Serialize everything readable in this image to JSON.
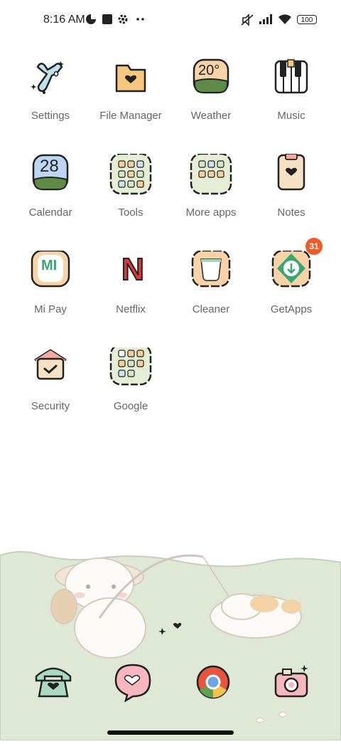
{
  "status_bar": {
    "time": "8:16 AM",
    "battery": "100",
    "icons": [
      "data-saver-icon",
      "stop-icon",
      "gear-icon",
      "more-dots-icon",
      "mute-icon",
      "signal-icon",
      "wifi-icon",
      "battery-icon"
    ]
  },
  "apps": [
    {
      "label": "Settings",
      "icon": "wrench-icon"
    },
    {
      "label": "File Manager",
      "icon": "folder-icon"
    },
    {
      "label": "Weather",
      "icon": "weather-icon",
      "text": "20°"
    },
    {
      "label": "Music",
      "icon": "piano-icon"
    },
    {
      "label": "Calendar",
      "icon": "calendar-icon",
      "text": "28"
    },
    {
      "label": "Tools",
      "icon": "tools-folder-icon"
    },
    {
      "label": "More apps",
      "icon": "more-apps-folder-icon"
    },
    {
      "label": "Notes",
      "icon": "notes-icon"
    },
    {
      "label": "Mi Pay",
      "icon": "mi-pay-icon",
      "text": "MI"
    },
    {
      "label": "Netflix",
      "icon": "netflix-icon",
      "text": "N"
    },
    {
      "label": "Cleaner",
      "icon": "cleaner-icon"
    },
    {
      "label": "GetApps",
      "icon": "getapps-icon",
      "badge": "31"
    },
    {
      "label": "Security",
      "icon": "security-house-icon"
    },
    {
      "label": "Google",
      "icon": "google-folder-icon"
    }
  ],
  "dock": [
    {
      "name": "phone-icon"
    },
    {
      "name": "messaging-icon"
    },
    {
      "name": "chrome-icon"
    },
    {
      "name": "camera-icon"
    }
  ],
  "colors": {
    "accent": "#ef5a28",
    "peach": "#f6d6a8",
    "grass": "#dfe8d4",
    "outline": "#222222"
  }
}
